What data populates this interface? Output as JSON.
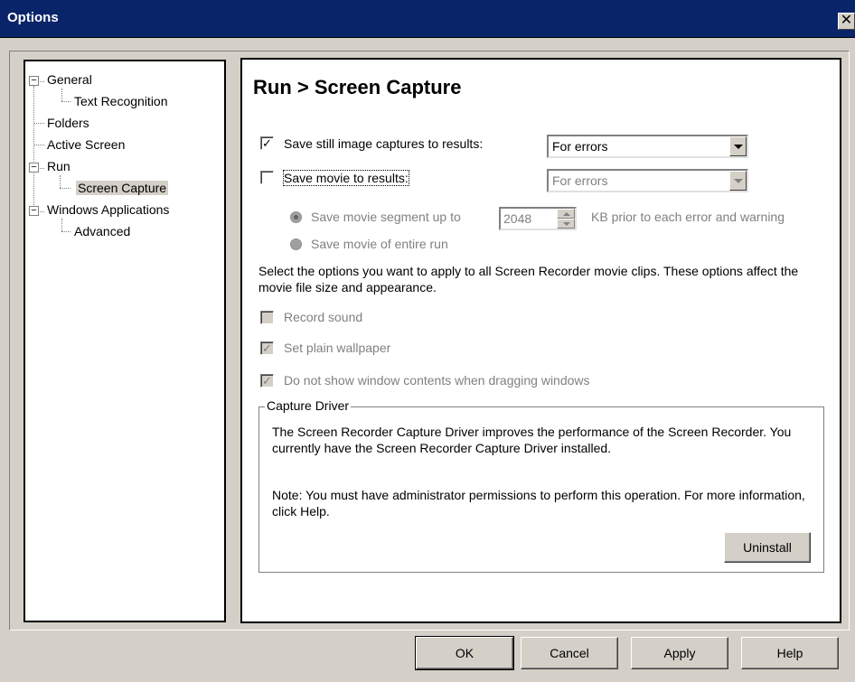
{
  "window": {
    "title": "Options",
    "close_glyph": "✕"
  },
  "tree": {
    "items": [
      {
        "label": "General",
        "expander": "−"
      },
      {
        "label": "Text Recognition"
      },
      {
        "label": "Folders"
      },
      {
        "label": "Active Screen"
      },
      {
        "label": "Run",
        "expander": "−"
      },
      {
        "label": "Screen Capture",
        "selected": true
      },
      {
        "label": "Windows Applications",
        "expander": "−"
      },
      {
        "label": "Advanced"
      }
    ]
  },
  "panel": {
    "title": "Run > Screen Capture",
    "still_images": {
      "label": "Save still image captures to results:",
      "checked": true,
      "check_glyph": "✓",
      "dropdown_value": "For errors"
    },
    "movie": {
      "label": "Save movie to results:",
      "checked": false,
      "dropdown_value": "For errors"
    },
    "segment": {
      "label": "Save movie segment up to",
      "value": "2048",
      "suffix": "KB prior to each error and warning"
    },
    "entire_run": {
      "label": "Save movie of entire run"
    },
    "description": "Select the options you want to apply to all Screen Recorder movie clips. These options affect the movie file size and appearance.",
    "record_sound": {
      "label": "Record sound",
      "checked": false
    },
    "plain_wallpaper": {
      "label": "Set plain wallpaper",
      "checked": true,
      "check_glyph": "✓"
    },
    "no_window_contents": {
      "label": "Do not show window contents when dragging windows",
      "checked": true,
      "check_glyph": "✓"
    },
    "capture_driver": {
      "legend": "Capture Driver",
      "text1": "The Screen Recorder Capture Driver improves the performance of the Screen Recorder. You currently have the Screen Recorder Capture Driver installed.",
      "text2": "Note: You must have administrator permissions to perform this operation. For more information, click Help.",
      "uninstall_label": "Uninstall"
    }
  },
  "buttons": {
    "ok": "OK",
    "cancel": "Cancel",
    "apply": "Apply",
    "help": "Help"
  }
}
